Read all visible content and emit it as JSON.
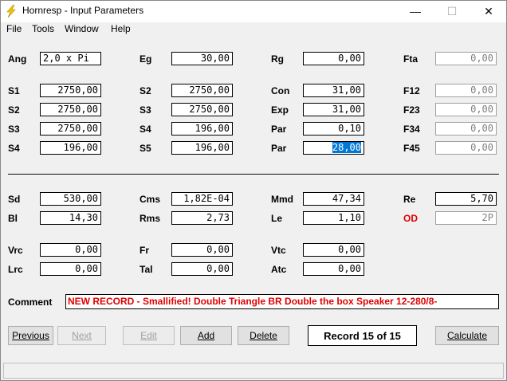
{
  "window": {
    "title": "Hornresp - Input Parameters",
    "minimize_glyph": "—",
    "maximize_glyph": "☐",
    "close_glyph": "✕"
  },
  "menu": {
    "items": [
      "File",
      "Tools",
      "Window",
      "Help"
    ]
  },
  "params": {
    "Ang": {
      "label": "Ang",
      "value": "2,0 x Pi"
    },
    "Eg": {
      "label": "Eg",
      "value": "30,00"
    },
    "Rg": {
      "label": "Rg",
      "value": "0,00"
    },
    "Fta": {
      "label": "Fta",
      "value": "0,00"
    },
    "S1": {
      "label": "S1",
      "value": "2750,00"
    },
    "S2a": {
      "label": "S2",
      "value": "2750,00"
    },
    "S3a": {
      "label": "S3",
      "value": "2750,00"
    },
    "S4a": {
      "label": "S4",
      "value": "196,00"
    },
    "S2b": {
      "label": "S2",
      "value": "2750,00"
    },
    "S3b": {
      "label": "S3",
      "value": "2750,00"
    },
    "S4b": {
      "label": "S4",
      "value": "196,00"
    },
    "S5": {
      "label": "S5",
      "value": "196,00"
    },
    "Con": {
      "label": "Con",
      "value": "31,00"
    },
    "Exp": {
      "label": "Exp",
      "value": "31,00"
    },
    "Par1": {
      "label": "Par",
      "value": "0,10"
    },
    "Par2": {
      "label": "Par",
      "value": "28,00"
    },
    "F12": {
      "label": "F12",
      "value": "0,00"
    },
    "F23": {
      "label": "F23",
      "value": "0,00"
    },
    "F34": {
      "label": "F34",
      "value": "0,00"
    },
    "F45": {
      "label": "F45",
      "value": "0,00"
    },
    "Sd": {
      "label": "Sd",
      "value": "530,00"
    },
    "Bl": {
      "label": "Bl",
      "value": "14,30"
    },
    "Cms": {
      "label": "Cms",
      "value": "1,82E-04"
    },
    "Rms": {
      "label": "Rms",
      "value": "2,73"
    },
    "Mmd": {
      "label": "Mmd",
      "value": "47,34"
    },
    "Le": {
      "label": "Le",
      "value": "1,10"
    },
    "Re": {
      "label": "Re",
      "value": "5,70"
    },
    "OD": {
      "label": "OD",
      "value": "2P"
    },
    "Vrc": {
      "label": "Vrc",
      "value": "0,00"
    },
    "Lrc": {
      "label": "Lrc",
      "value": "0,00"
    },
    "Fr": {
      "label": "Fr",
      "value": "0,00"
    },
    "Tal": {
      "label": "Tal",
      "value": "0,00"
    },
    "Vtc": {
      "label": "Vtc",
      "value": "0,00"
    },
    "Atc": {
      "label": "Atc",
      "value": "0,00"
    }
  },
  "comment": {
    "label": "Comment",
    "value": "NEW RECORD - Smallified! Double Triangle BR Double the box Speaker 12-280/8-"
  },
  "buttons": {
    "previous": "Previous",
    "next": "Next",
    "edit": "Edit",
    "add": "Add",
    "delete": "Delete",
    "calculate": "Calculate"
  },
  "record": "Record 15 of 15",
  "colors": {
    "od_label": "#e00000",
    "comment_text": "#e00000",
    "selection": "#0078d7",
    "app_icon": "#f5c400"
  }
}
